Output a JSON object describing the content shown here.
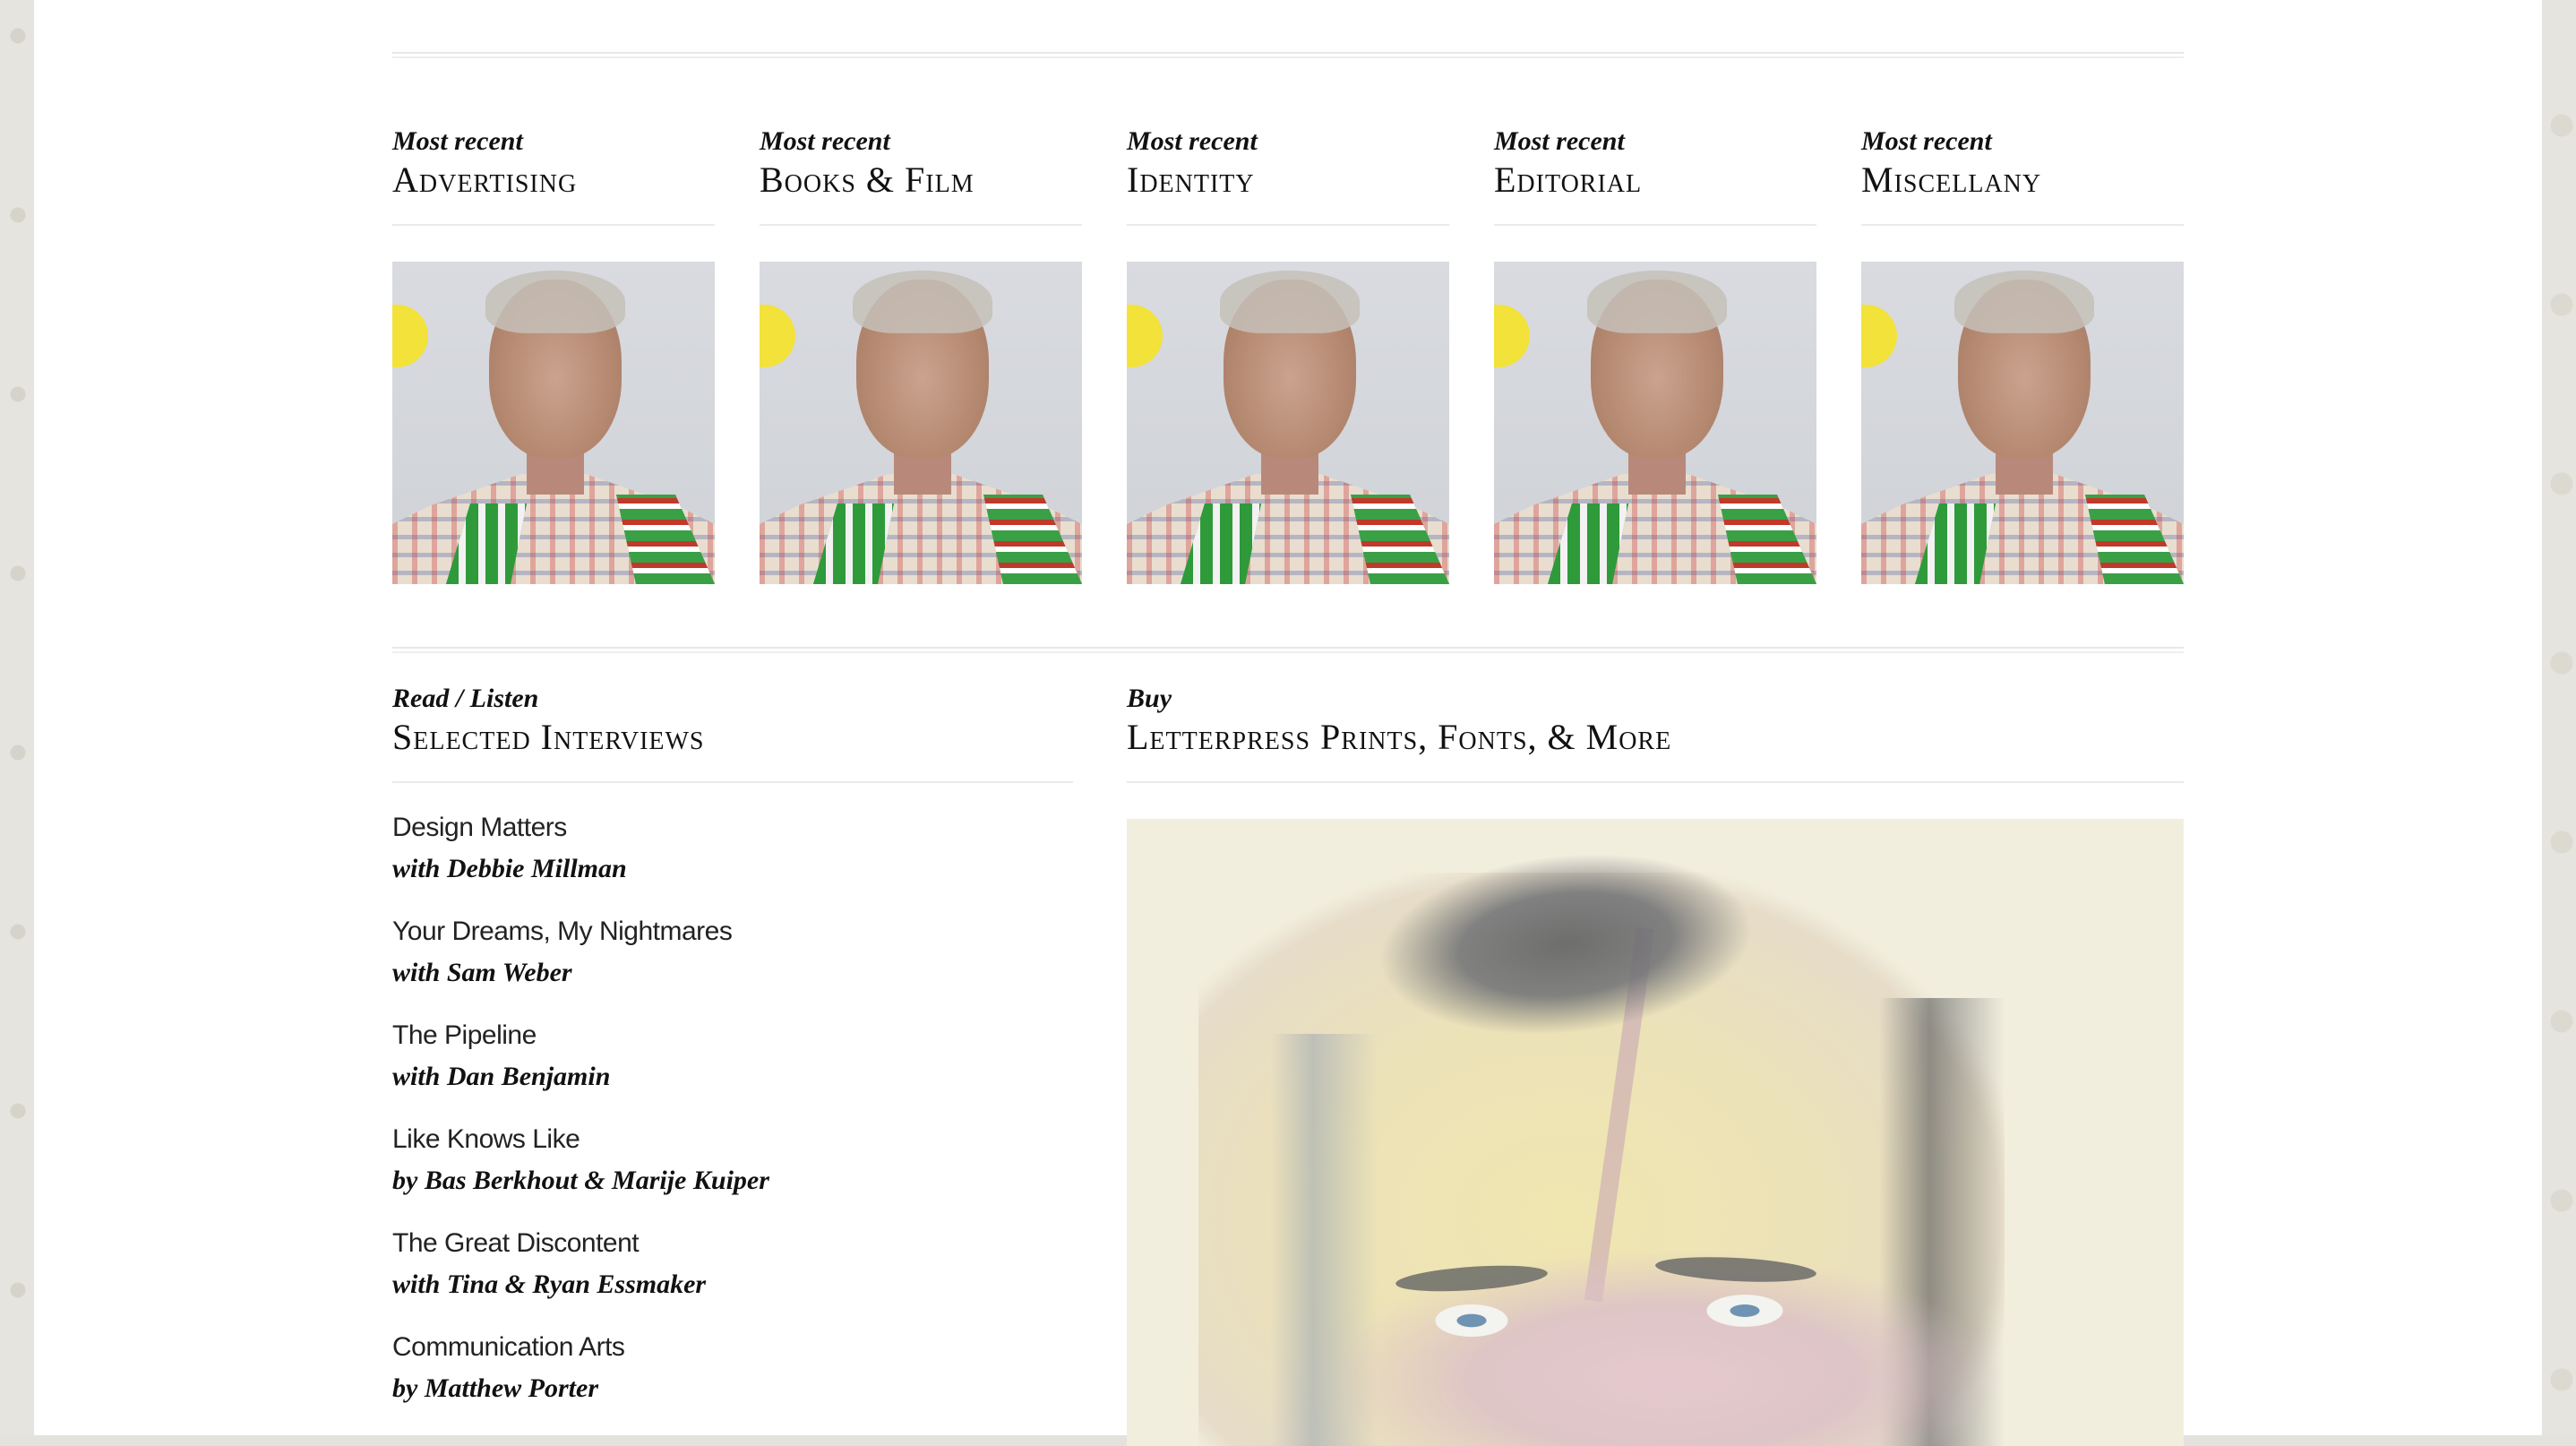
{
  "categories": [
    {
      "kicker": "Most recent",
      "title": "Advertising"
    },
    {
      "kicker": "Most recent",
      "title": "Books & Film"
    },
    {
      "kicker": "Most recent",
      "title": "Identity"
    },
    {
      "kicker": "Most recent",
      "title": "Editorial"
    },
    {
      "kicker": "Most recent",
      "title": "Miscellany"
    }
  ],
  "interviews_section": {
    "kicker": "Read / Listen",
    "title": "Selected Interviews",
    "items": [
      {
        "title": "Design Matters",
        "by": "with Debbie Millman"
      },
      {
        "title": "Your Dreams, My Nightmares",
        "by": "with Sam Weber"
      },
      {
        "title": "The Pipeline",
        "by": "with Dan Benjamin"
      },
      {
        "title": "Like Knows Like",
        "by": "by Bas Berkhout & Marije Kuiper"
      },
      {
        "title": "The Great Discontent",
        "by": "with Tina & Ryan Essmaker"
      },
      {
        "title": "Communication Arts",
        "by": "by Matthew Porter"
      }
    ]
  },
  "shop_section": {
    "kicker": "Buy",
    "title": "Letterpress Prints, Fonts, & More"
  },
  "colors": {
    "sticker": "#f2e23a",
    "page_bg": "#ffffff",
    "rule": "#e8e8e8"
  }
}
